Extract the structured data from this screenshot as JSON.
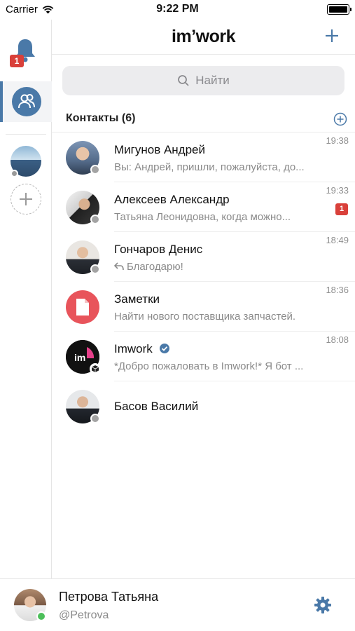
{
  "status_bar": {
    "carrier": "Carrier",
    "time": "9:22 PM"
  },
  "rail": {
    "notification_badge": "1"
  },
  "header": {
    "logo": "im’work"
  },
  "search": {
    "placeholder": "Найти"
  },
  "section": {
    "title": "Контакты (6)"
  },
  "contacts": [
    {
      "name": "Мигунов Андрей",
      "preview": "Вы: Андрей, пришли, пожалуйста, до...",
      "time": "19:38",
      "badge": ""
    },
    {
      "name": "Алексеев Александр",
      "preview": "Татьяна Леонидовна, когда можно...",
      "time": "19:33",
      "badge": "1"
    },
    {
      "name": "Гончаров Денис",
      "preview": "Благодарю!",
      "time": "18:49",
      "badge": ""
    },
    {
      "name": "Заметки",
      "preview": "Найти нового поставщика запчастей.",
      "time": "18:36",
      "badge": ""
    },
    {
      "name": "Imwork",
      "preview": "*Добро пожаловать в Imwork!* Я бот ...",
      "time": "18:08",
      "badge": ""
    },
    {
      "name": "Басов Василий",
      "preview": "",
      "time": "",
      "badge": ""
    }
  ],
  "profile": {
    "name": "Петрова Татьяна",
    "handle": "@Petrova"
  },
  "colors": {
    "accent": "#4a79a8",
    "badge": "#d9403a",
    "online": "#4cbf5a",
    "notes": "#e8545b"
  }
}
